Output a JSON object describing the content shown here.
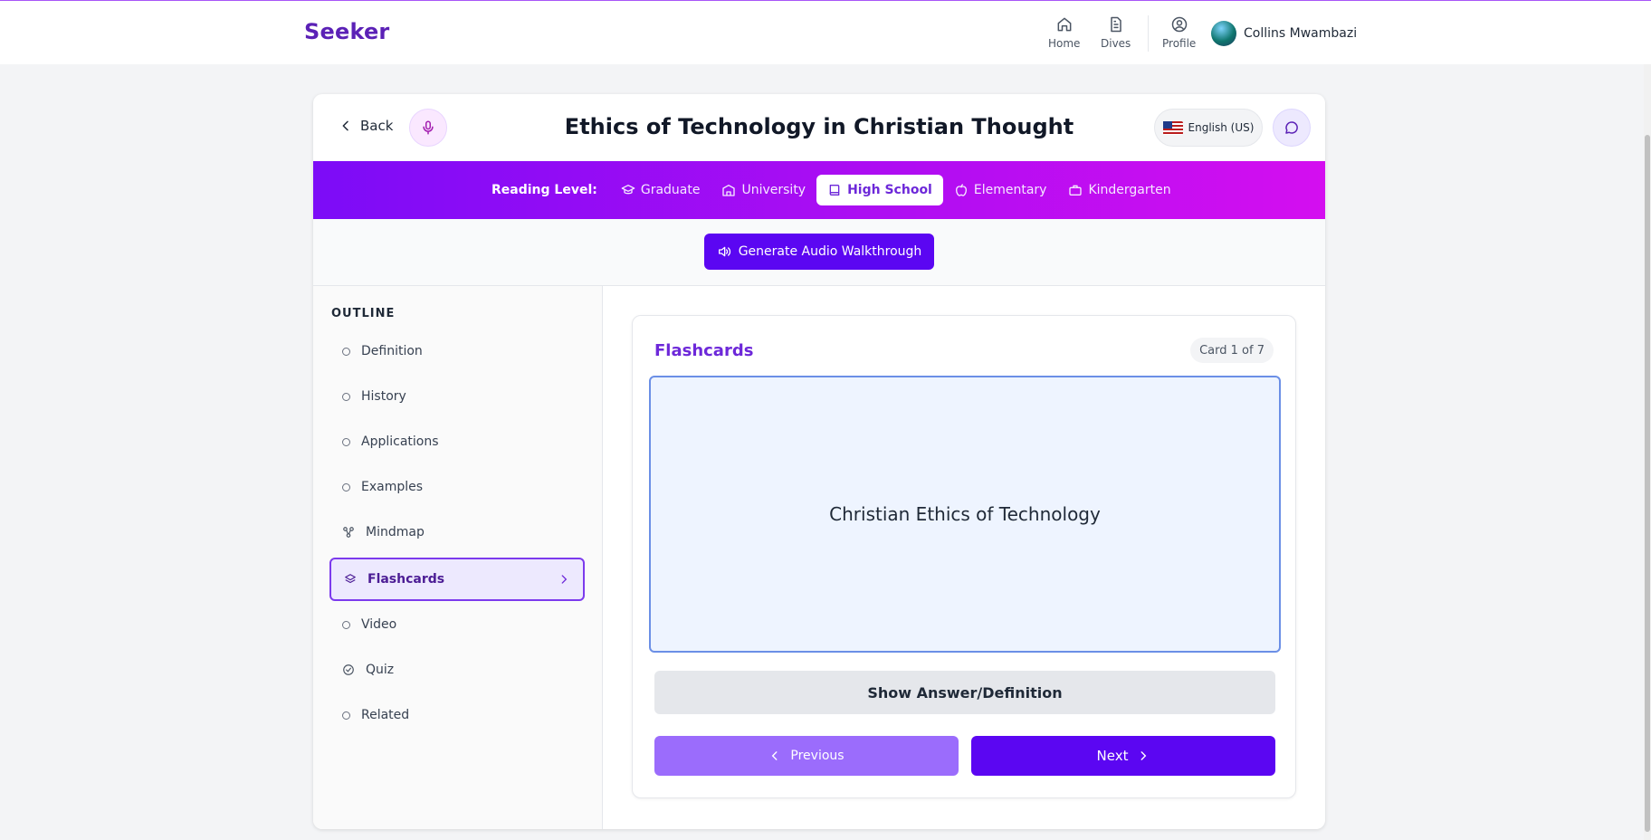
{
  "nav": {
    "brand": "Seeker",
    "home_label": "Home",
    "dives_label": "Dives",
    "profile_label": "Profile",
    "user_name": "Collins Mwambazi"
  },
  "header": {
    "back_label": "Back",
    "title": "Ethics of Technology in Christian Thought",
    "language": "English (US)"
  },
  "reading_level": {
    "label": "Reading Level:",
    "levels": [
      {
        "label": "Graduate",
        "icon": "graduation-cap-icon"
      },
      {
        "label": "University",
        "icon": "building-icon"
      },
      {
        "label": "High School",
        "icon": "book-icon",
        "active": true
      },
      {
        "label": "Elementary",
        "icon": "apple-icon"
      },
      {
        "label": "Kindergarten",
        "icon": "backpack-icon"
      }
    ]
  },
  "audio": {
    "button_label": "Generate Audio Walkthrough"
  },
  "outline": {
    "title": "OUTLINE",
    "items": [
      {
        "label": "Definition",
        "icon": "circle-icon"
      },
      {
        "label": "History",
        "icon": "circle-icon"
      },
      {
        "label": "Applications",
        "icon": "circle-icon"
      },
      {
        "label": "Examples",
        "icon": "circle-icon"
      },
      {
        "label": "Mindmap",
        "icon": "mindmap-icon"
      },
      {
        "label": "Flashcards",
        "icon": "layers-icon",
        "active": true
      },
      {
        "label": "Video",
        "icon": "circle-icon"
      },
      {
        "label": "Quiz",
        "icon": "check-circle-icon"
      },
      {
        "label": "Related",
        "icon": "circle-icon"
      }
    ]
  },
  "flashcards": {
    "title": "Flashcards",
    "counter": "Card 1 of 7",
    "term": "Christian Ethics of Technology",
    "show_label": "Show Answer/Definition",
    "prev_label": "Previous",
    "next_label": "Next"
  },
  "colors": {
    "brand": "#5b21b6",
    "primary_button": "#5b06f2",
    "active_border": "#7c3aed"
  }
}
